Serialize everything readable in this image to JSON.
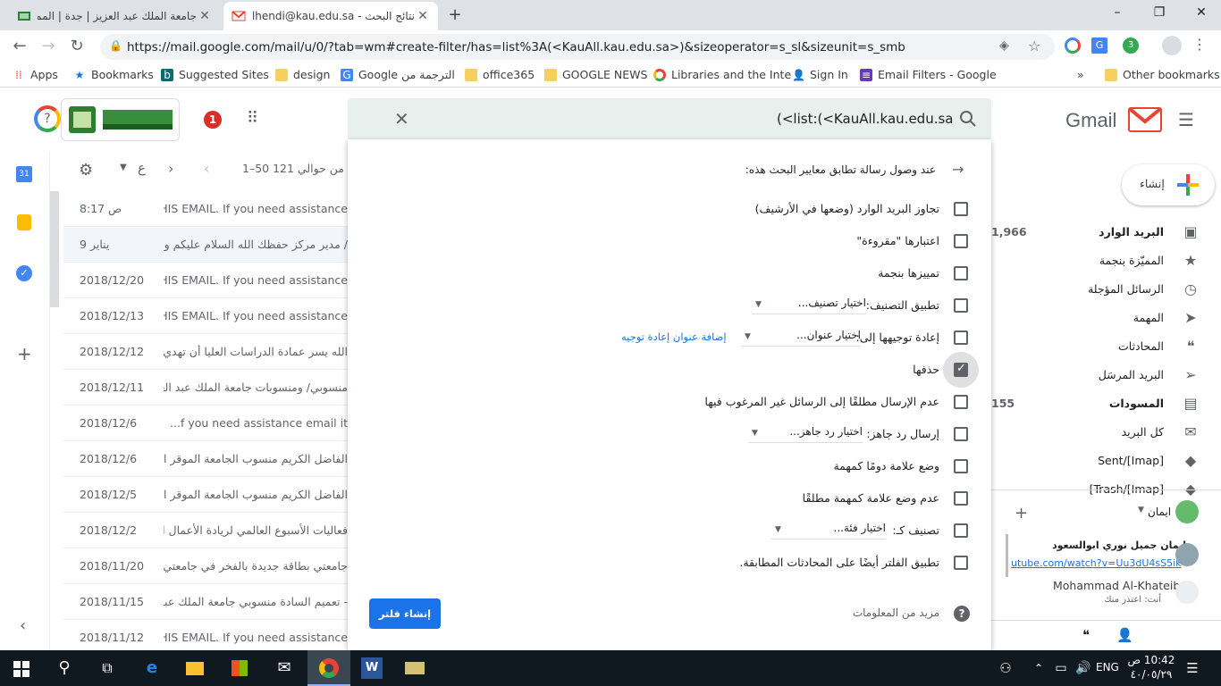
{
  "browser": {
    "tabs": [
      {
        "title": "جامعة الملك عبد العزيز | جدة | المملكة"
      },
      {
        "title": "نتائج البحث - ialhendi@kau.edu.sa"
      }
    ],
    "new_tab": "+",
    "win_min": "–",
    "win_max": "❐",
    "win_close": "✕",
    "url": "https://mail.google.com/mail/u/0/?tab=wm#create-filter/has=list%3A(<KauAll.kau.edu.sa>)&sizeoperator=s_sl&sizeunit=s_smb",
    "bookmarks": [
      {
        "label": "Apps",
        "icon": "apps-grid-icon"
      },
      {
        "label": "Bookmarks",
        "icon": "star-icon"
      },
      {
        "label": "Suggested Sites",
        "icon": "bing-icon"
      },
      {
        "label": "design",
        "icon": "folder-icon"
      },
      {
        "label": "Google الترجمة من",
        "icon": "translate-icon"
      },
      {
        "label": "office365",
        "icon": "folder-icon"
      },
      {
        "label": "GOOGLE NEWS",
        "icon": "folder-icon"
      },
      {
        "label": "Libraries and the Inte",
        "icon": "chrome-icon"
      },
      {
        "label": "Sign In",
        "icon": "person-icon"
      },
      {
        "label": "Email Filters - Google",
        "icon": "forms-icon"
      }
    ],
    "more_bookmarks": "»",
    "other_bookmarks": "Other bookmarks"
  },
  "gmail": {
    "logo_text": "Gmail",
    "notification_count": "1",
    "search_query": "(<list:(<KauAll.kau.edu.sa",
    "compose_label": "إنشاء",
    "pagination": "1–50 من حوالي 121",
    "lang_button": "ع",
    "nav": [
      {
        "label": "البريد الوارد",
        "count": "1,966",
        "bold": true,
        "icon": "inbox-icon"
      },
      {
        "label": "المميّزة بنجمة",
        "count": "",
        "bold": false,
        "icon": "star-icon"
      },
      {
        "label": "الرسائل المؤجلة",
        "count": "",
        "bold": false,
        "icon": "clock-icon"
      },
      {
        "label": "المهمة",
        "count": "",
        "bold": false,
        "icon": "label-important-icon"
      },
      {
        "label": "المحادثات",
        "count": "",
        "bold": false,
        "icon": "chat-icon"
      },
      {
        "label": "البريد المرسَل",
        "count": "",
        "bold": false,
        "icon": "send-icon"
      },
      {
        "label": "المسودات",
        "count": "155",
        "bold": true,
        "icon": "draft-icon"
      },
      {
        "label": "كل البريد",
        "count": "",
        "bold": false,
        "icon": "mail-icon"
      },
      {
        "label": "[Imap]/Sent",
        "count": "",
        "bold": false,
        "icon": "label-icon"
      },
      {
        "label": "[Imap]/Trash]",
        "count": "",
        "bold": false,
        "icon": "label-icon"
      }
    ],
    "hangouts": {
      "user": "ايمان",
      "contacts": [
        {
          "name": "ايمان جميل نوري ابوالسعود",
          "status": "utube.com/watch?v=Uu3dU4sS5ik"
        },
        {
          "name": "Mohammad Al-Khateib",
          "status": "أنت: اعتذر منك"
        }
      ]
    },
    "mail_rows": [
      {
        "date": "8:17 ص",
        "snippet": "TO THIS EMAIL. If you need assistance..."
      },
      {
        "date": "9 يناير",
        "snippet": "/ مدير مركز حفظك الله السلام عليكم ورحمة الله..."
      },
      {
        "date": "2018/12/20",
        "snippet": "THIS EMAIL. If you need assistance..."
      },
      {
        "date": "2018/12/13",
        "snippet": "THIS EMAIL. If you need assistance"
      },
      {
        "date": "2018/12/12",
        "snippet": "الله يسر عمادة الدراسات العليا أن تهدي سـ.. ..."
      },
      {
        "date": "2018/12/11",
        "snippet": "منسوبي/ ومنسوبات جامعة الملك عبد العزيز ..."
      },
      {
        "date": "2018/12/6",
        "snippet": "f you need assistance email it..."
      },
      {
        "date": "2018/12/6",
        "snippet": "الفاضل الكريم منسوب الجامعة الموقر السلا..."
      },
      {
        "date": "2018/12/5",
        "snippet": "الفاضل الكريم منسوب الجامعة الموقر السلا..."
      },
      {
        "date": "2018/12/2",
        "snippet": "فعاليات الأسبوع العالمي لريادة الأعمال الـ .."
      },
      {
        "date": "2018/11/20",
        "snippet": "جامعتي بطاقة جديدة بالفخر في جامعتي من هـ..."
      },
      {
        "date": "2018/11/15",
        "snippet": "- تعميم السادة منسوبي جامعة الملك عبدالعز..."
      },
      {
        "date": "2018/11/12",
        "snippet": "THIS EMAIL. If you need assistance"
      }
    ]
  },
  "filter": {
    "header": "عند وصول رسالة تطابق معايير البحث هذه:",
    "options": [
      {
        "label": "تجاوز البريد الوارد (وضعها في الأرشيف)",
        "checked": false
      },
      {
        "label": "اعتبارها \"مقروءة\"",
        "checked": false
      },
      {
        "label": "تمييزها بنجمة",
        "checked": false
      },
      {
        "label": "تطبيق التصنيف:",
        "checked": false,
        "select": "اختيار تصنيف..."
      },
      {
        "label": "إعادة توجيهها إلى:",
        "checked": false,
        "select": "اختيار عنوان...",
        "link": "إضافة عنوان إعادة توجيه"
      },
      {
        "label": "حذفها",
        "checked": true
      },
      {
        "label": "عدم الإرسال مطلقًا إلى الرسائل غير المرغوب فيها",
        "checked": false
      },
      {
        "label": "إرسال رد جاهز:",
        "checked": false,
        "select": "اختيار رد جاهز..."
      },
      {
        "label": "وضع علامة دومًا كمهمة",
        "checked": false
      },
      {
        "label": "عدم وضع علامة كمهمة مطلقًا",
        "checked": false
      },
      {
        "label": "تصنيف كـ:",
        "checked": false,
        "select": "اختيار فئة..."
      },
      {
        "label": "تطبيق الفلتر أيضًا على المحادثات المطابقة.",
        "checked": false
      }
    ],
    "more_info": "مزيد من المعلومات",
    "create_button": "إنشاء فلتر"
  },
  "taskbar": {
    "time": "10:42 ص",
    "date": "٤٠/٠٥/٢٩",
    "lang": "ENG"
  },
  "colors": {
    "primary_blue": "#1a73e8",
    "gmail_red": "#ea4335",
    "search_bg": "#e8f0ed"
  }
}
